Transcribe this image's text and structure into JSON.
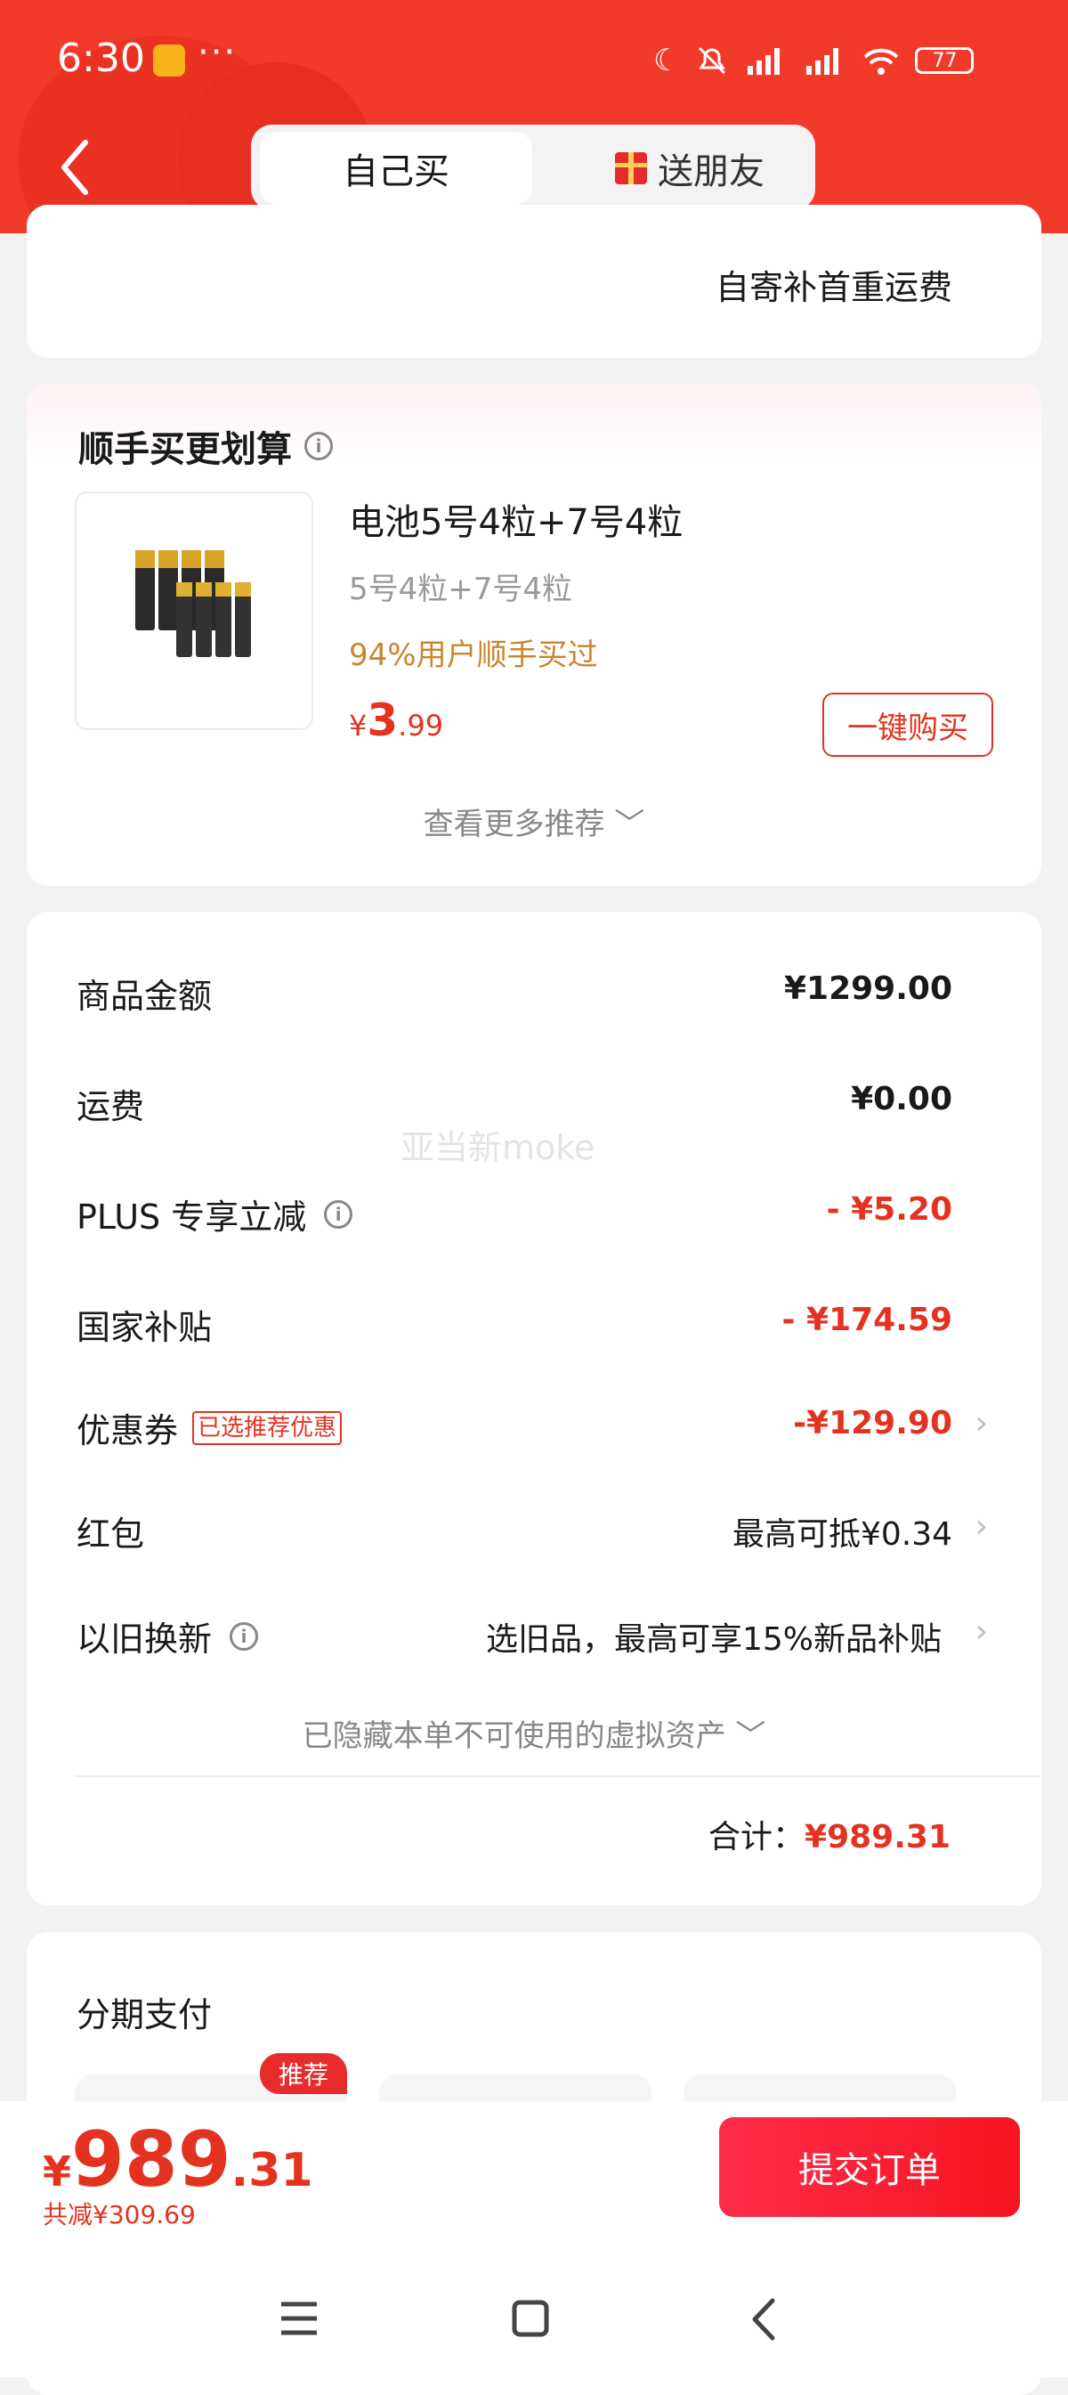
{
  "status_bar": {
    "time": "6:30",
    "dots": "···",
    "battery": "77"
  },
  "header": {
    "tab_self": "自己买",
    "tab_friend": "送朋友"
  },
  "shipping": {
    "line1": "自寄补首重运费"
  },
  "upsell": {
    "title": "顺手买更划算",
    "product_name": "电池5号4粒+7号4粒",
    "product_spec": "5号4粒+7号4粒",
    "product_tag": "94%用户顺手买过",
    "price_symbol": "¥",
    "price_int": "3",
    "price_dec": ".99",
    "buy_button": "一键购买",
    "more": "查看更多推荐 ﹀"
  },
  "summary": {
    "rows": [
      {
        "label": "商品金额",
        "value": "¥1299.00"
      },
      {
        "label": "运费",
        "value": "¥0.00"
      },
      {
        "label": "PLUS 专享立减",
        "value": "- ¥5.20"
      },
      {
        "label": "国家补贴",
        "value": "- ¥174.59"
      },
      {
        "label": "优惠券",
        "badge": "已选推荐优惠",
        "value": "-¥129.90"
      },
      {
        "label": "红包",
        "value": "最高可抵¥0.34"
      },
      {
        "label": "以旧换新",
        "value": "选旧品，最高可享15%新品补贴"
      }
    ],
    "hidden_assets": "已隐藏本单不可使用的虚拟资产 ﹀",
    "total_label": "合计：",
    "total_value": "¥989.31",
    "watermark": "亚当新moke"
  },
  "installment": {
    "title": "分期支付",
    "badge": "推荐"
  },
  "bottom_bar": {
    "price_symbol": "¥",
    "price_int": "989",
    "price_dec": ".31",
    "saved": "共减¥309.69",
    "submit": "提交订单"
  },
  "colors": {
    "brand_red": "#f23a2a",
    "price_red": "#e33320",
    "tag_orange": "#c8862e"
  }
}
